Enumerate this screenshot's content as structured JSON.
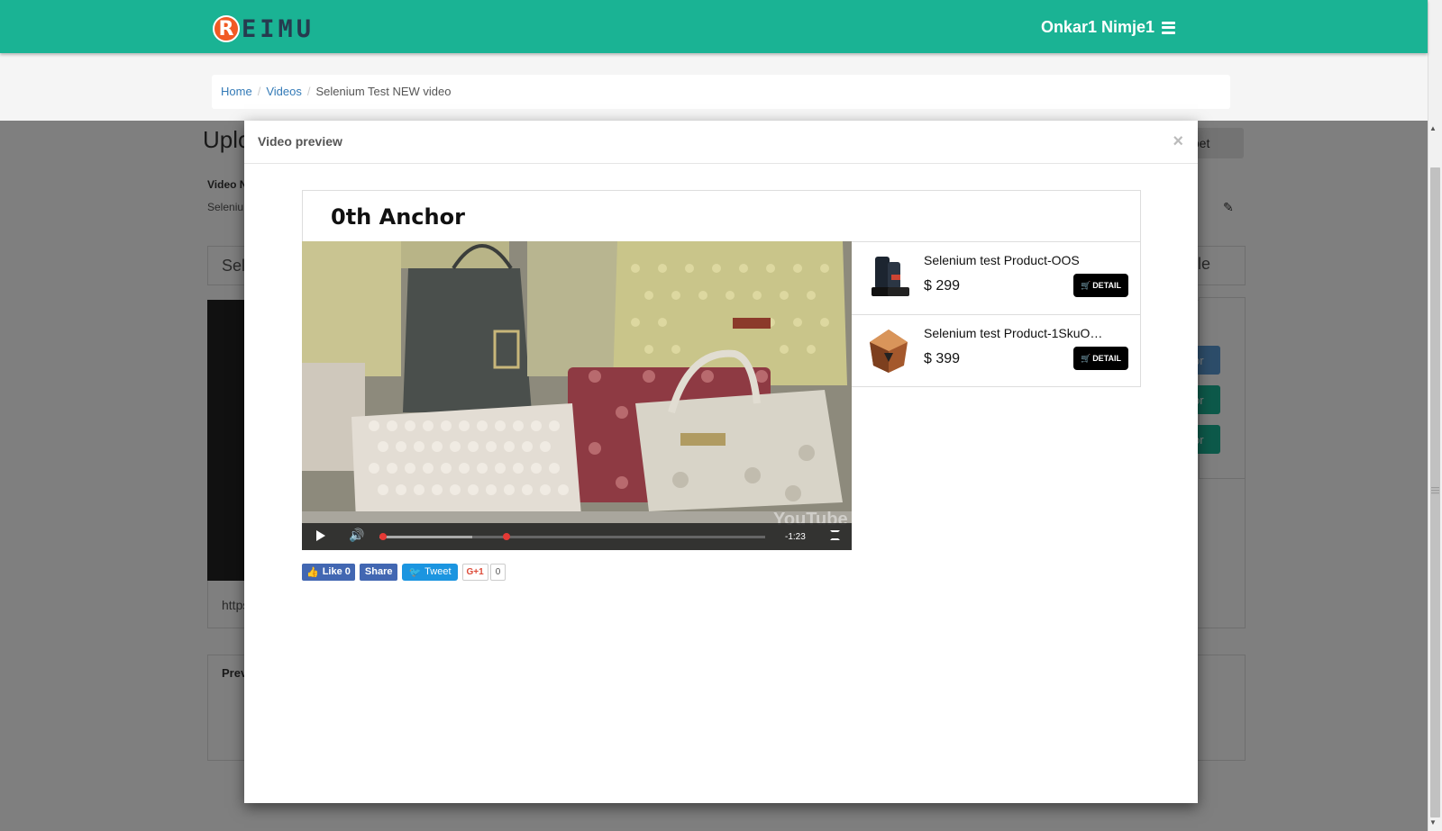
{
  "header": {
    "logo_letter": "R",
    "logo_text": "EIMU",
    "user_name": "Onkar1 Nimje1",
    "accent_color": "#1ab394"
  },
  "breadcrumb": {
    "items": [
      "Home",
      "Videos"
    ],
    "current": "Selenium Test NEW video"
  },
  "background_page": {
    "title": "Uplo",
    "video_label": "Video N",
    "video_value": "Seleniu",
    "select_fragment": "Sel",
    "snippet_button": "ippet",
    "style_fragment": "yle",
    "url_fragment": "https",
    "preview_fragment": "Prev",
    "button_fragment": "or"
  },
  "modal": {
    "title": "Video preview",
    "close_label": "×",
    "widget_title": "0th Anchor",
    "player": {
      "time_remaining": "-1:23",
      "progress_fraction": 0.33,
      "buffer_fraction": 0.24,
      "watermark": "YouTube"
    },
    "products": [
      {
        "name": "Selenium test Product-OOS",
        "price": "$ 299",
        "detail_label": "DETAIL",
        "thumb": "boots"
      },
      {
        "name": "Selenium test Product-1SkuO…",
        "price": "$ 399",
        "detail_label": "DETAIL",
        "thumb": "perfume"
      }
    ],
    "social": {
      "fb_like": "Like 0",
      "fb_share": "Share",
      "tweet": "Tweet",
      "gplus": "G+1",
      "gplus_count": "0"
    }
  }
}
